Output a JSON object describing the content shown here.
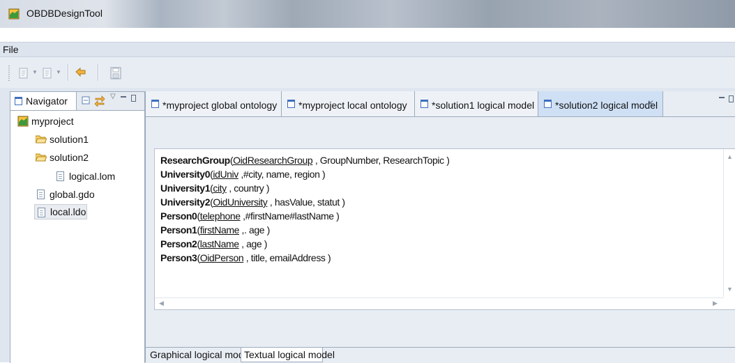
{
  "app": {
    "title": "OBDBDesignTool"
  },
  "menu": {
    "file": "File"
  },
  "navigator": {
    "tab_label": "Navigator",
    "tree": [
      {
        "label": "myproject"
      },
      {
        "label": "solution1"
      },
      {
        "label": "solution2"
      },
      {
        "label": "logical.lom"
      },
      {
        "label": "global.gdo"
      },
      {
        "label": "local.ldo"
      }
    ]
  },
  "editor": {
    "tabs": [
      {
        "label": "*myproject global ontology"
      },
      {
        "label": "*myproject local ontology"
      },
      {
        "label": "*solution1 logical model"
      },
      {
        "label": "*solution2 logical model"
      }
    ],
    "lines": [
      {
        "entity": "ResearchGroup",
        "open": "(",
        "key": "OidResearchGroup",
        "rest": " ,  GroupNumber, ResearchTopic )"
      },
      {
        "entity": "University0",
        "open": "(",
        "key": "idUniv",
        "rest": " ,#city, name, region )"
      },
      {
        "entity": "University1",
        "open": "(",
        "key": "city",
        "rest": " ,  country )"
      },
      {
        "entity": "University2",
        "open": "(",
        "key": "OidUniversity",
        "rest": " ,  hasValue, statut )"
      },
      {
        "entity": "Person0",
        "open": "(",
        "key": "telephone",
        "rest": " ,#firstName#lastName )"
      },
      {
        "entity": "Person1",
        "open": "(",
        "key": "firstName",
        "rest": " ,. age )"
      },
      {
        "entity": "Person2",
        "open": "(",
        "key": "lastName",
        "rest": " ,  age )"
      },
      {
        "entity": "Person3",
        "open": "(",
        "key": "OidPerson",
        "rest": " ,  title, emailAddress )"
      }
    ],
    "bottom_tabs": [
      {
        "label": "Graphical logical model"
      },
      {
        "label": "Textual logical model"
      }
    ]
  },
  "colors": {
    "active_tab": "#cfe0f5",
    "panel_border": "#9daabb",
    "menu_bg": "#dde4ee"
  }
}
